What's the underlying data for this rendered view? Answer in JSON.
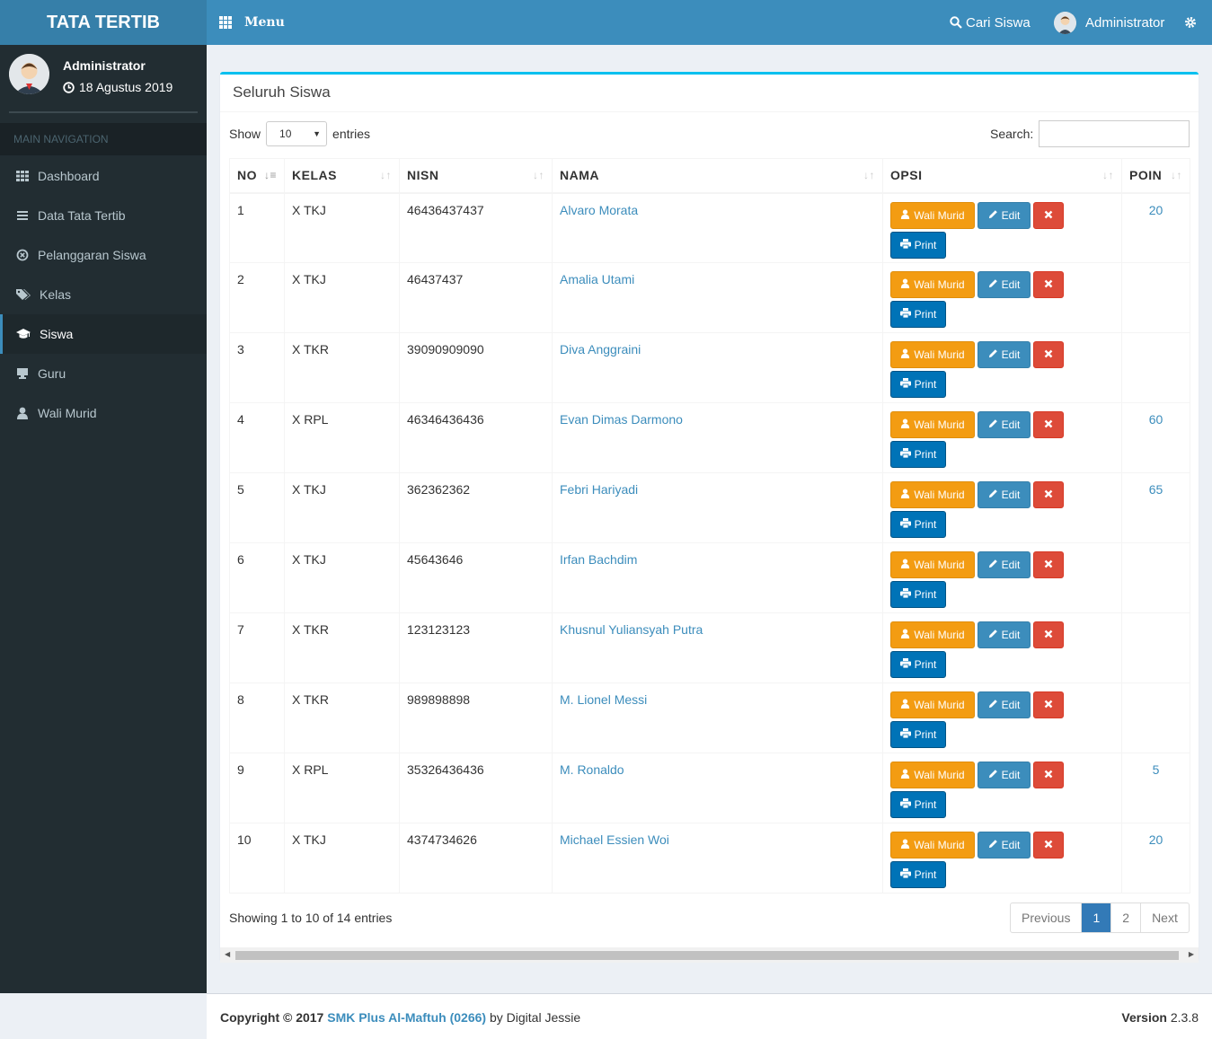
{
  "app": {
    "logo": "TATA TERTIB",
    "menu_label": "Menu",
    "search_label": "Cari Siswa",
    "user_label": "Administrator"
  },
  "sidebar": {
    "user_name": "Administrator",
    "date": "18 Agustus 2019",
    "nav_header": "MAIN NAVIGATION",
    "items": [
      {
        "label": "Dashboard",
        "icon": "dashboard-icon"
      },
      {
        "label": "Data Tata Tertib",
        "icon": "list-icon"
      },
      {
        "label": "Pelanggaran Siswa",
        "icon": "ban-icon"
      },
      {
        "label": "Kelas",
        "icon": "tags-icon"
      },
      {
        "label": "Siswa",
        "icon": "graduation-cap-icon",
        "active": true
      },
      {
        "label": "Guru",
        "icon": "desk-icon"
      },
      {
        "label": "Wali Murid",
        "icon": "user-icon"
      }
    ]
  },
  "box": {
    "title": "Seluruh Siswa",
    "show_label": "Show",
    "entries_value": "10",
    "entries_label": "entries",
    "search_label": "Search:",
    "columns": [
      "NO",
      "KELAS",
      "NISN",
      "NAMA",
      "OPSI",
      "POIN"
    ],
    "rows": [
      {
        "no": "1",
        "kelas": "X TKJ",
        "nisn": "46436437437",
        "nama": "Alvaro Morata",
        "poin": "20"
      },
      {
        "no": "2",
        "kelas": "X TKJ",
        "nisn": "46437437",
        "nama": "Amalia Utami",
        "poin": ""
      },
      {
        "no": "3",
        "kelas": "X TKR",
        "nisn": "39090909090",
        "nama": "Diva Anggraini",
        "poin": ""
      },
      {
        "no": "4",
        "kelas": "X RPL",
        "nisn": "46346436436",
        "nama": "Evan Dimas Darmono",
        "poin": "60"
      },
      {
        "no": "5",
        "kelas": "X TKJ",
        "nisn": "362362362",
        "nama": "Febri Hariyadi",
        "poin": "65"
      },
      {
        "no": "6",
        "kelas": "X TKJ",
        "nisn": "45643646",
        "nama": "Irfan Bachdim",
        "poin": ""
      },
      {
        "no": "7",
        "kelas": "X TKR",
        "nisn": "123123123",
        "nama": "Khusnul Yuliansyah Putra",
        "poin": ""
      },
      {
        "no": "8",
        "kelas": "X TKR",
        "nisn": "989898898",
        "nama": "M. Lionel Messi",
        "poin": ""
      },
      {
        "no": "9",
        "kelas": "X RPL",
        "nisn": "35326436436",
        "nama": "M. Ronaldo",
        "poin": "5"
      },
      {
        "no": "10",
        "kelas": "X TKJ",
        "nisn": "4374734626",
        "nama": "Michael Essien Woi",
        "poin": "20"
      }
    ],
    "buttons": {
      "wali": "Wali Murid",
      "edit": "Edit",
      "print": "Print"
    },
    "info": "Showing 1 to 10 of 14 entries",
    "pager": {
      "previous": "Previous",
      "pages": [
        "1",
        "2"
      ],
      "current": "1",
      "next": "Next"
    }
  },
  "footer": {
    "copyright_prefix": "Copyright © 2017",
    "school": "SMK Plus Al-Maftuh (0266)",
    "by": "by Digital Jessie",
    "version_label": "Version",
    "version": "2.3.8"
  },
  "colors": {
    "header": "#3c8dbc",
    "logo_bg": "#367fa9",
    "sidebar": "#222d32",
    "box_border": "#00c0ef",
    "wali": "#f39c12",
    "edit": "#3c8dbc",
    "delete": "#dd4b39",
    "print": "#0073b7"
  }
}
